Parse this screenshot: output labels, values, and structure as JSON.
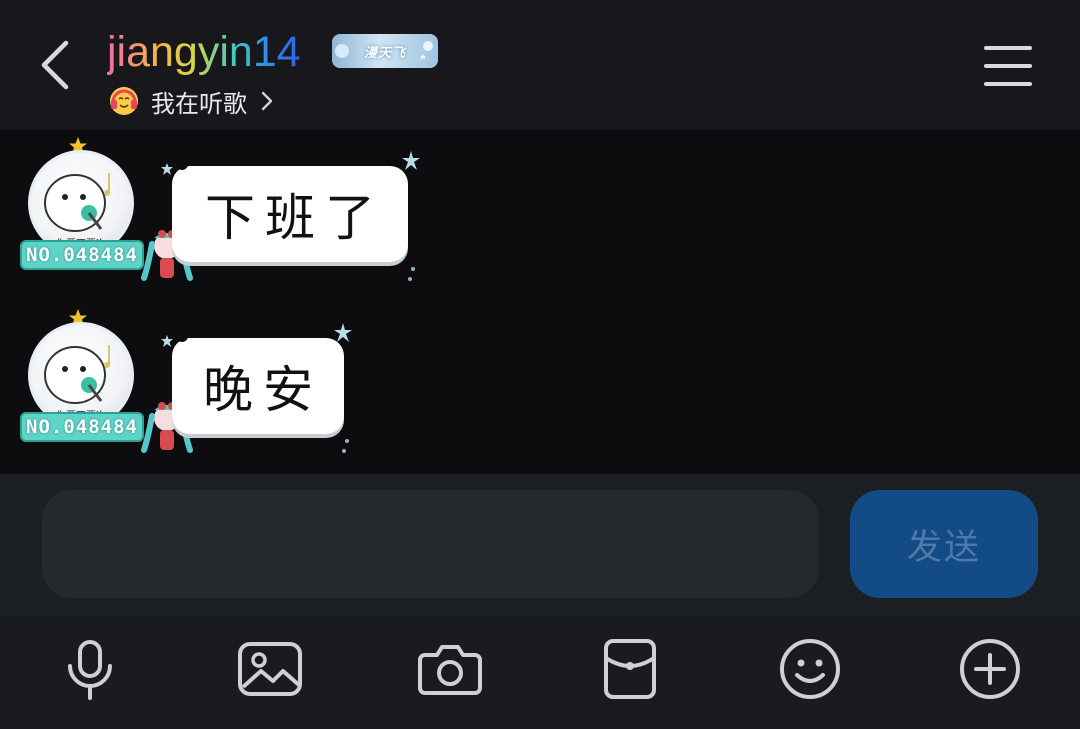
{
  "header": {
    "title": "jiangyin14",
    "badge_text": "漫天飞",
    "status_text": "我在听歌",
    "icons": {
      "back": "back-chevron-icon",
      "menu": "hamburger-menu-icon",
      "status": "headphones-emoji-icon",
      "status_more": "chevron-right-icon"
    }
  },
  "messages": [
    {
      "text": "下班了",
      "avatar_caption": "你要不要次",
      "level_badge": "NO.048484"
    },
    {
      "text": "晚安",
      "avatar_caption": "你要不要次",
      "level_badge": "NO.048484"
    }
  ],
  "composer": {
    "placeholder": "",
    "value": "",
    "send_label": "发送"
  },
  "toolbar": {
    "items": [
      "microphone-icon",
      "image-icon",
      "camera-icon",
      "red-packet-icon",
      "emoji-icon",
      "plus-icon"
    ]
  },
  "colors": {
    "header_bg": "#18181c",
    "chat_bg": "#0d0d0f",
    "input_bar_bg": "#1c1f23",
    "send_bg": "#134b86",
    "send_text": "#4d7aa6",
    "level_badge": "#5fd3c7"
  }
}
